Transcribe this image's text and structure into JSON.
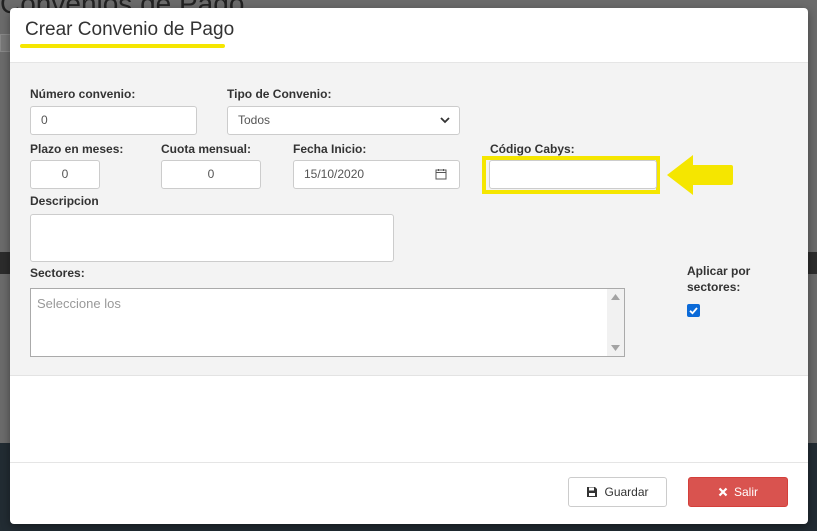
{
  "background": {
    "page_title": "Convenios de Pago"
  },
  "modal": {
    "title": "Crear Convenio de Pago",
    "fields": {
      "numero_convenio": {
        "label": "Número convenio:",
        "value": "0"
      },
      "tipo_convenio": {
        "label": "Tipo de Convenio:",
        "value": "Todos"
      },
      "plazo_meses": {
        "label": "Plazo en meses:",
        "value": "0"
      },
      "cuota_mensual": {
        "label": "Cuota mensual:",
        "value": "0"
      },
      "fecha_inicio": {
        "label": "Fecha Inicio:",
        "value": "15/10/2020"
      },
      "codigo_cabys": {
        "label": "Código Cabys:",
        "value": ""
      },
      "descripcion": {
        "label": "Descripcion",
        "value": ""
      },
      "sectores": {
        "label": "Sectores:",
        "placeholder": "Seleccione los"
      },
      "aplicar_por_sectores": {
        "label_line1": "Aplicar por",
        "label_line2": "sectores:",
        "checked": true
      }
    },
    "footer": {
      "save_label": "Guardar",
      "exit_label": "Salir"
    }
  },
  "colors": {
    "highlight": "#f5e600",
    "danger": "#d9534f",
    "checkbox": "#0b6ad8"
  },
  "icons": {
    "save": "floppy-icon",
    "exit": "times-icon",
    "calendar": "calendar-icon",
    "select": "chevron-down-icon"
  }
}
